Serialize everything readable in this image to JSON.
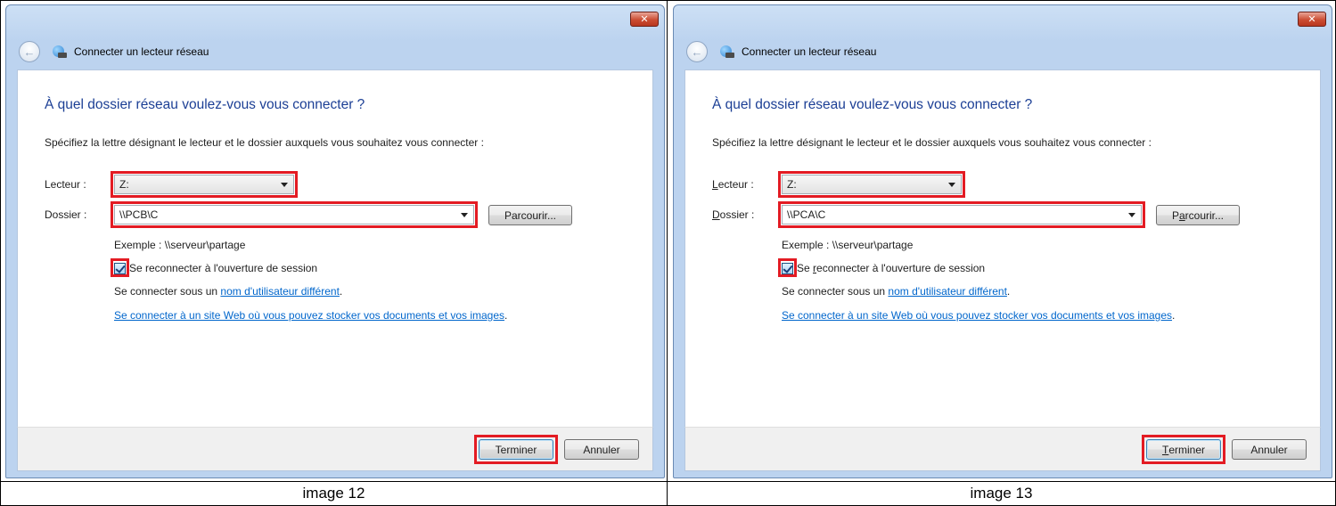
{
  "panels": [
    {
      "window_title": "Connecter un lecteur réseau",
      "heading": "À quel dossier réseau voulez-vous vous connecter ?",
      "instruction": "Spécifiez la lettre désignant le lecteur et le dossier auxquels vous souhaitez vous connecter :",
      "drive_label": "Lecteur :",
      "drive_value": "Z:",
      "folder_label": "Dossier :",
      "folder_value": "\\\\PCB\\C",
      "browse_label": "Parcourir...",
      "example": "Exemple : \\\\serveur\\partage",
      "reconnect_label": "Se reconnecter à l'ouverture de session",
      "connect_as_prefix": "Se connecter sous un ",
      "connect_as_link": "nom d'utilisateur différent",
      "connect_as_suffix": ".",
      "website_link": "Se connecter à un site Web où vous pouvez stocker vos documents et vos images",
      "website_suffix": ".",
      "finish_label": "Terminer",
      "cancel_label": "Annuler",
      "close_glyph": "✕",
      "caption": "image 12"
    },
    {
      "window_title": "Connecter un lecteur réseau",
      "heading": "À quel dossier réseau voulez-vous vous connecter ?",
      "instruction": "Spécifiez la lettre désignant le lecteur et le dossier auxquels vous souhaitez vous connecter :",
      "drive_label_pre": "",
      "drive_label_u": "L",
      "drive_label_post": "ecteur :",
      "drive_value": "Z:",
      "folder_label_u": "D",
      "folder_label_post": "ossier :",
      "folder_value": "\\\\PCA\\C",
      "browse_label_pre": "P",
      "browse_label_u": "a",
      "browse_label_post": "rcourir...",
      "example": "Exemple : \\\\serveur\\partage",
      "reconnect_pre": "Se ",
      "reconnect_u": "r",
      "reconnect_post": "econnecter à l'ouverture de session",
      "connect_as_prefix": "Se connecter sous un ",
      "connect_as_link": "nom d'utilisateur différent",
      "connect_as_suffix": ".",
      "website_link": "Se connecter à un site Web où vous pouvez stocker vos documents et vos images",
      "website_suffix": ".",
      "finish_u": "T",
      "finish_post": "erminer",
      "cancel_label": "Annuler",
      "close_glyph": "✕",
      "caption": "image 13"
    }
  ],
  "icons": {
    "back": "back-arrow-icon",
    "network": "network-drive-icon",
    "close": "close-icon",
    "dropdown": "chevron-down-icon",
    "checkbox": "checkbox-checked-icon"
  },
  "colors": {
    "highlight": "#e31b23",
    "heading": "#1c3f95",
    "link": "#0066cc",
    "titlebar": "#bcd3ef"
  }
}
